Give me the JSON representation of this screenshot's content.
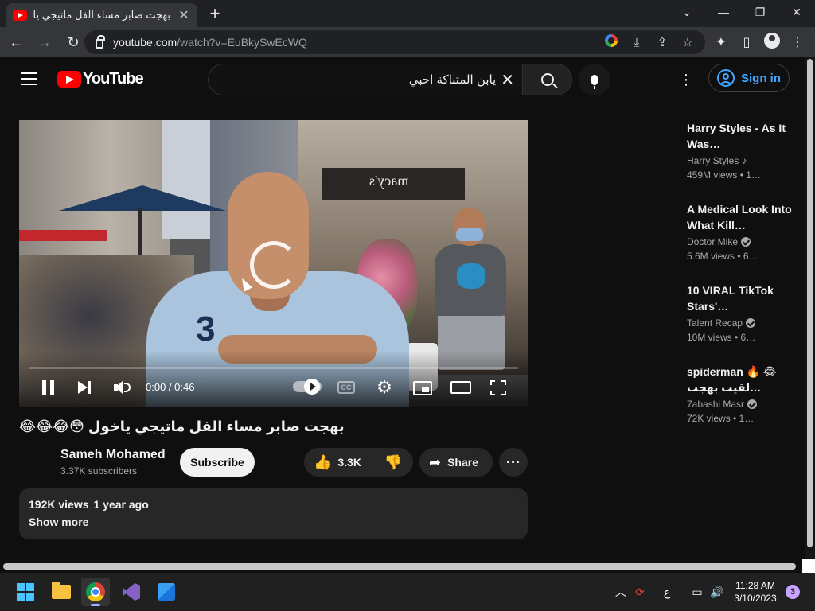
{
  "browser": {
    "tab_title": "بهجت صابر مساء الفل ماتيجي ياخول",
    "tab_close": "✕",
    "new_tab": "+",
    "url_domain": "youtube.com",
    "url_path": "/watch?v=EuBkySwEcWQ",
    "window_controls": {
      "minimize": "—",
      "maximize": "❐",
      "close": "✕",
      "tab_search": "⌄"
    },
    "nav": {
      "back": "←",
      "forward": "→",
      "reload": "↻"
    },
    "toolbar_icons": {
      "install": "⤓",
      "share": "⇪",
      "bookmark": "☆",
      "extensions": "✦",
      "side_panel": "▯",
      "menu": "⋮"
    }
  },
  "youtube": {
    "logo_text": "YouTube",
    "search_query": "يابن المتناكة احبي",
    "search_clear": "✕",
    "more_menu": "⋮",
    "sign_in_label": "Sign in"
  },
  "player": {
    "store_sign": "macy's",
    "shirt_text": "3",
    "time": "0:00 / 0:46",
    "cc_label": "CC",
    "settings_glyph": "⚙",
    "progress": 0.0
  },
  "video": {
    "title": "بهجت صابر مساء الفل ماتيجي ياخول 😳😂😂😂",
    "channel_name": "Sameh Mohamed",
    "subscribers": "3.37K subscribers",
    "subscribe_label": "Subscribe",
    "like_icon": "👍",
    "dislike_icon": "👎",
    "likes": "3.3K",
    "share_icon": "➦",
    "share_label": "Share",
    "more_label": "···",
    "views": "192K views",
    "age": "1 year ago",
    "show_more": "Show more"
  },
  "recommendations": [
    {
      "title": "Harry Styles - As It Was…",
      "channel": "Harry Styles",
      "badge": "music",
      "stats": "459M views  • 1…"
    },
    {
      "title": "A Medical Look Into What Kill…",
      "channel": "Doctor Mike",
      "badge": "verified",
      "stats": "5.6M views  • 6…"
    },
    {
      "title": "10 VIRAL TikTok Stars'…",
      "channel": "Talent Recap",
      "badge": "verified",
      "stats": "10M views  • 6…"
    },
    {
      "title": "spiderman 🔥 😂 لقيت بهجت…",
      "channel": "7abashi Masr",
      "badge": "verified",
      "stats": "72K views  • 1…"
    }
  ],
  "taskbar": {
    "tray_chevron": "︿",
    "tray_sync": "⟳",
    "tray_lang": "ع",
    "tray_network": "▭",
    "tray_volume": "🔊",
    "time": "11:28 AM",
    "date": "3/10/2023",
    "notification_count": "3"
  }
}
